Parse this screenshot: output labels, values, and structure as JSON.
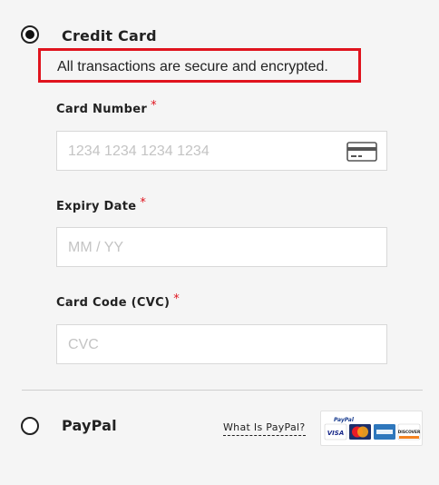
{
  "credit_card": {
    "label": "Credit Card",
    "selected": true,
    "secure_message": "All transactions are secure and encrypted."
  },
  "fields": {
    "card_number": {
      "label": "Card Number",
      "required_mark": "*",
      "placeholder": "1234 1234 1234 1234"
    },
    "expiry": {
      "label": "Expiry Date",
      "required_mark": "*",
      "placeholder": "MM / YY"
    },
    "cvc": {
      "label": "Card Code (CVC)",
      "required_mark": "*",
      "placeholder": "CVC"
    }
  },
  "paypal": {
    "label": "PayPal",
    "selected": false,
    "info_link": "What Is PayPal?",
    "badge": {
      "brand": "PayPal",
      "cards": [
        "VISA",
        "MasterCard",
        "AMEX",
        "DISCOVER"
      ]
    }
  },
  "colors": {
    "highlight_border": "#e0141e",
    "required": "#e0141e",
    "placeholder": "#c4c4c4",
    "background": "#f5f5f5"
  },
  "icons": [
    "radio-selected",
    "radio-unselected",
    "credit-card-icon",
    "paypal-badge"
  ]
}
